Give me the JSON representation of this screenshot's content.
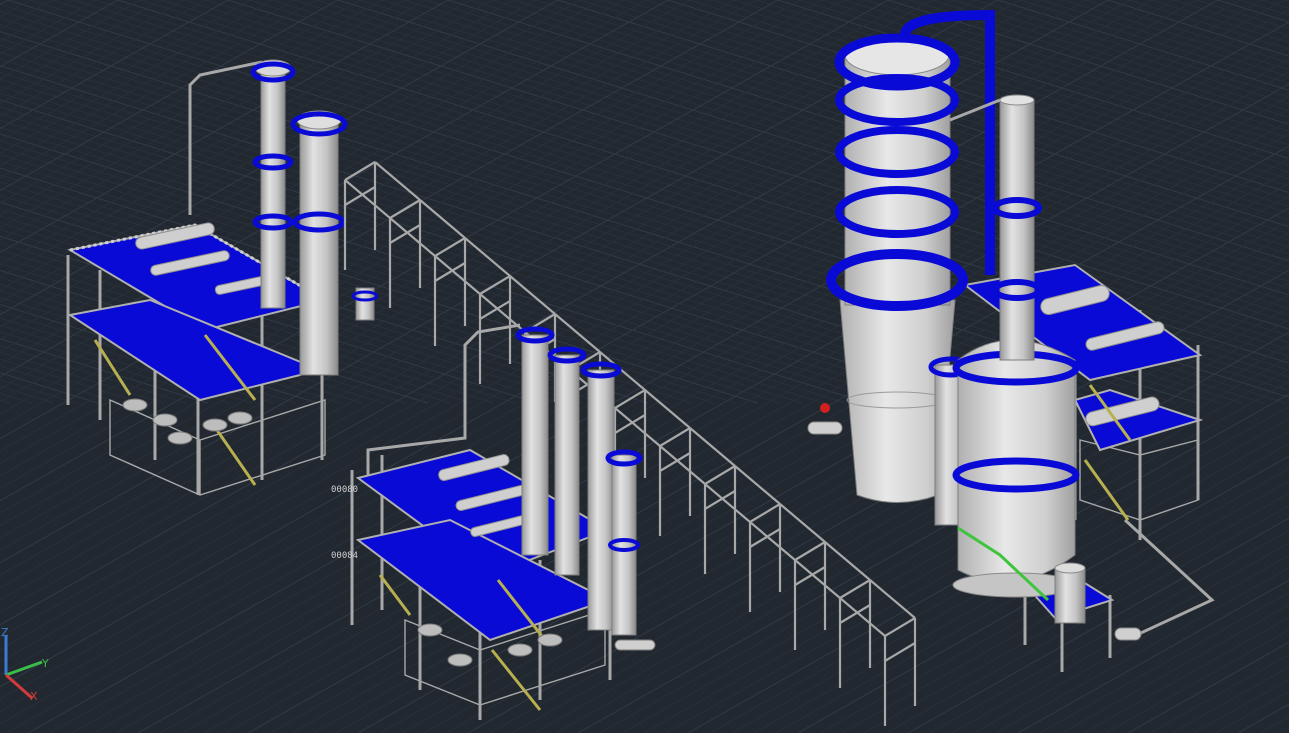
{
  "ucs": {
    "x": "X",
    "y": "Y",
    "z": "Z"
  },
  "tags": {
    "tag_a": "00080",
    "tag_b": "00084"
  },
  "colors": {
    "background": "#212830",
    "grid_minor": "#29303a",
    "grid_major": "#323a46",
    "structure": "#a8a8a8",
    "deck_blue": "#0a0ad6",
    "vessel": "#c9c9c9",
    "vessel_shade": "#9e9e9e",
    "stair": "#b8b050",
    "ucs_x": "#d23b3b",
    "ucs_y": "#3bbd4a",
    "ucs_z": "#3b7bd2",
    "pipe_green": "#3ec43e",
    "valve_red": "#d02020"
  }
}
